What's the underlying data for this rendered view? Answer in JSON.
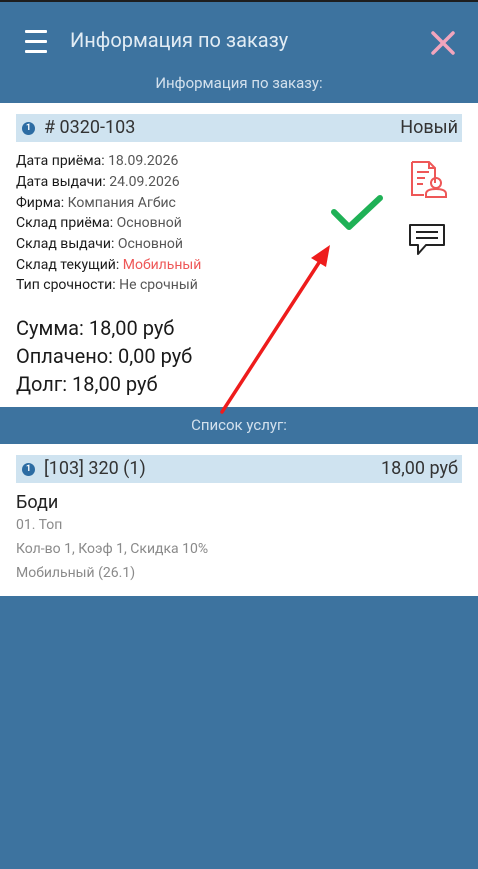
{
  "app": {
    "title": "Информация по заказу",
    "icons": {
      "menu": "hamburger-menu-icon",
      "close": "close-icon"
    },
    "colors": {
      "primary": "#3d739f",
      "close_icon": "#f2a5bd",
      "strip": "#cfe3f0",
      "accent_red": "#ee5757",
      "check_green": "#1fb156"
    }
  },
  "order_section": {
    "header": "Информация по заказу:",
    "number_badge": "1",
    "order_number": "# 0320-103",
    "status": "Новый",
    "details": [
      {
        "label": "Дата приёма: ",
        "value": "18.09.2026"
      },
      {
        "label": "Дата выдачи: ",
        "value": "24.09.2026"
      },
      {
        "label": "Фирма: ",
        "value": "Компания Агбис"
      },
      {
        "label": "Склад приёма: ",
        "value": "Основной"
      },
      {
        "label": "Склад выдачи: ",
        "value": "Основной"
      },
      {
        "label": "Склад текущий: ",
        "value": "Мобильный",
        "highlight": true
      },
      {
        "label": "Тип срочности: ",
        "value": "Не срочный"
      }
    ],
    "sum": "Сумма: 18,00 руб",
    "paid": "Оплачено: 0,00 руб",
    "debt": "Долг: 18,00 руб",
    "actions": {
      "document": "document-person-icon",
      "comment": "comment-icon",
      "annotation": "check-icon"
    }
  },
  "services_section": {
    "header": "Список услуг:",
    "item": {
      "badge": "1",
      "title": "[103] 320 (1)",
      "price": "18,00 руб",
      "name": "Боди",
      "type": "01. Топ",
      "params": "Кол-во 1, Коэф 1, Скидка 10%",
      "location": "Мобильный (26.1)"
    }
  }
}
